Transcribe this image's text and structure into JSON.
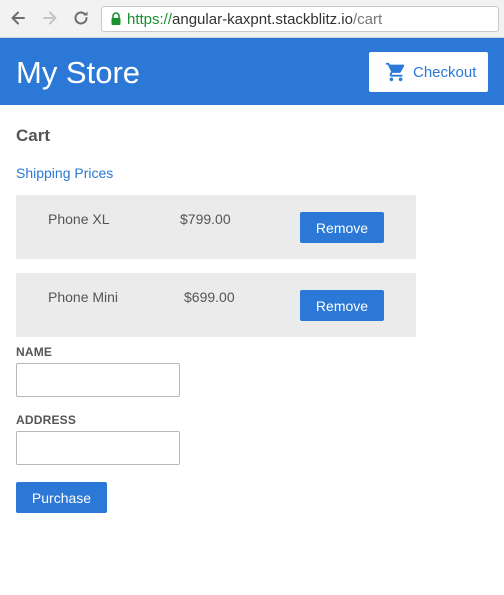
{
  "browser": {
    "url_scheme": "https://",
    "url_host": "angular-kaxpnt.stackblitz.io",
    "url_path": "/cart"
  },
  "header": {
    "title": "My Store",
    "checkout_label": "Checkout"
  },
  "cart": {
    "heading": "Cart",
    "shipping_link": "Shipping Prices",
    "items": [
      {
        "name": "Phone XL",
        "price": "$799.00",
        "remove_label": "Remove"
      },
      {
        "name": "Phone Mini",
        "price": "$699.00",
        "remove_label": "Remove"
      }
    ]
  },
  "form": {
    "name_label": "NAME",
    "name_value": "",
    "address_label": "ADDRESS",
    "address_value": "",
    "purchase_label": "Purchase"
  },
  "colors": {
    "primary": "#2b78d6",
    "item_background": "#ebebeb",
    "secure_green": "#1a8f2e"
  },
  "icons": {
    "back": "arrow-left-icon",
    "forward": "arrow-right-icon",
    "reload": "reload-icon",
    "lock": "lock-icon",
    "cart": "shopping-cart-icon"
  }
}
